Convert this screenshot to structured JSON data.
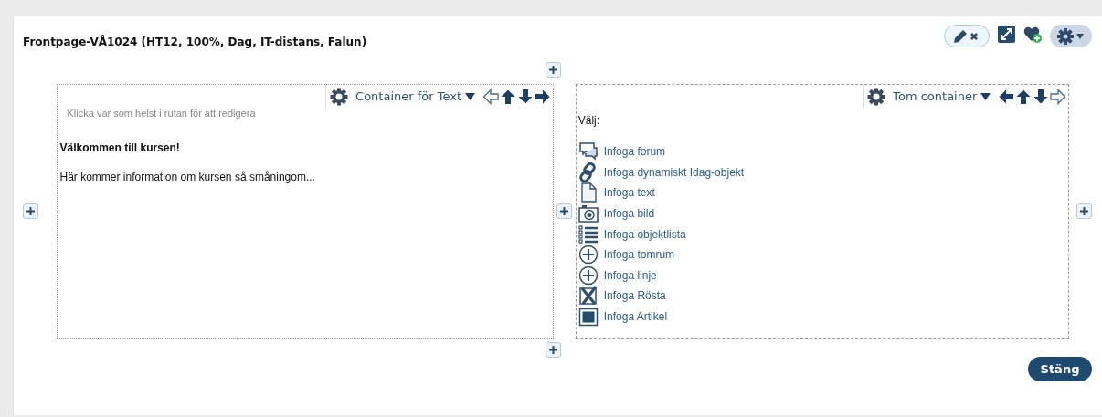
{
  "title": "Frontpage-VÅ1024 (HT12, 100%, Dag, IT-distans, Falun)",
  "containers": [
    {
      "menu_label": "Container för Text",
      "arrows": [
        {
          "kind": "left",
          "disabled": true
        },
        {
          "kind": "up",
          "disabled": false
        },
        {
          "kind": "down",
          "disabled": false
        },
        {
          "kind": "right",
          "disabled": false
        }
      ],
      "hint": "Klicka var som helst i rutan för att redigera",
      "heading": "Välkommen till kursen!",
      "body": "Här kommer information om kursen så småningom..."
    },
    {
      "menu_label": "Tom container",
      "arrows": [
        {
          "kind": "left",
          "disabled": false
        },
        {
          "kind": "up",
          "disabled": false
        },
        {
          "kind": "down",
          "disabled": false
        },
        {
          "kind": "right",
          "disabled": true
        }
      ],
      "prompt": "Välj:",
      "options": [
        {
          "kind": "forum",
          "label": "Infoga forum"
        },
        {
          "kind": "link",
          "label": "Infoga dynamiskt Idag-objekt"
        },
        {
          "kind": "document",
          "label": "Infoga text"
        },
        {
          "kind": "camera",
          "label": "Infoga bild"
        },
        {
          "kind": "list",
          "label": "Infoga objektlista"
        },
        {
          "kind": "plus",
          "label": "Infoga tomrum"
        },
        {
          "kind": "plus",
          "label": "Infoga linje"
        },
        {
          "kind": "cross",
          "label": "Infoga Rösta"
        },
        {
          "kind": "square",
          "label": "Infoga Artikel"
        }
      ]
    }
  ],
  "close_button": "Stäng"
}
